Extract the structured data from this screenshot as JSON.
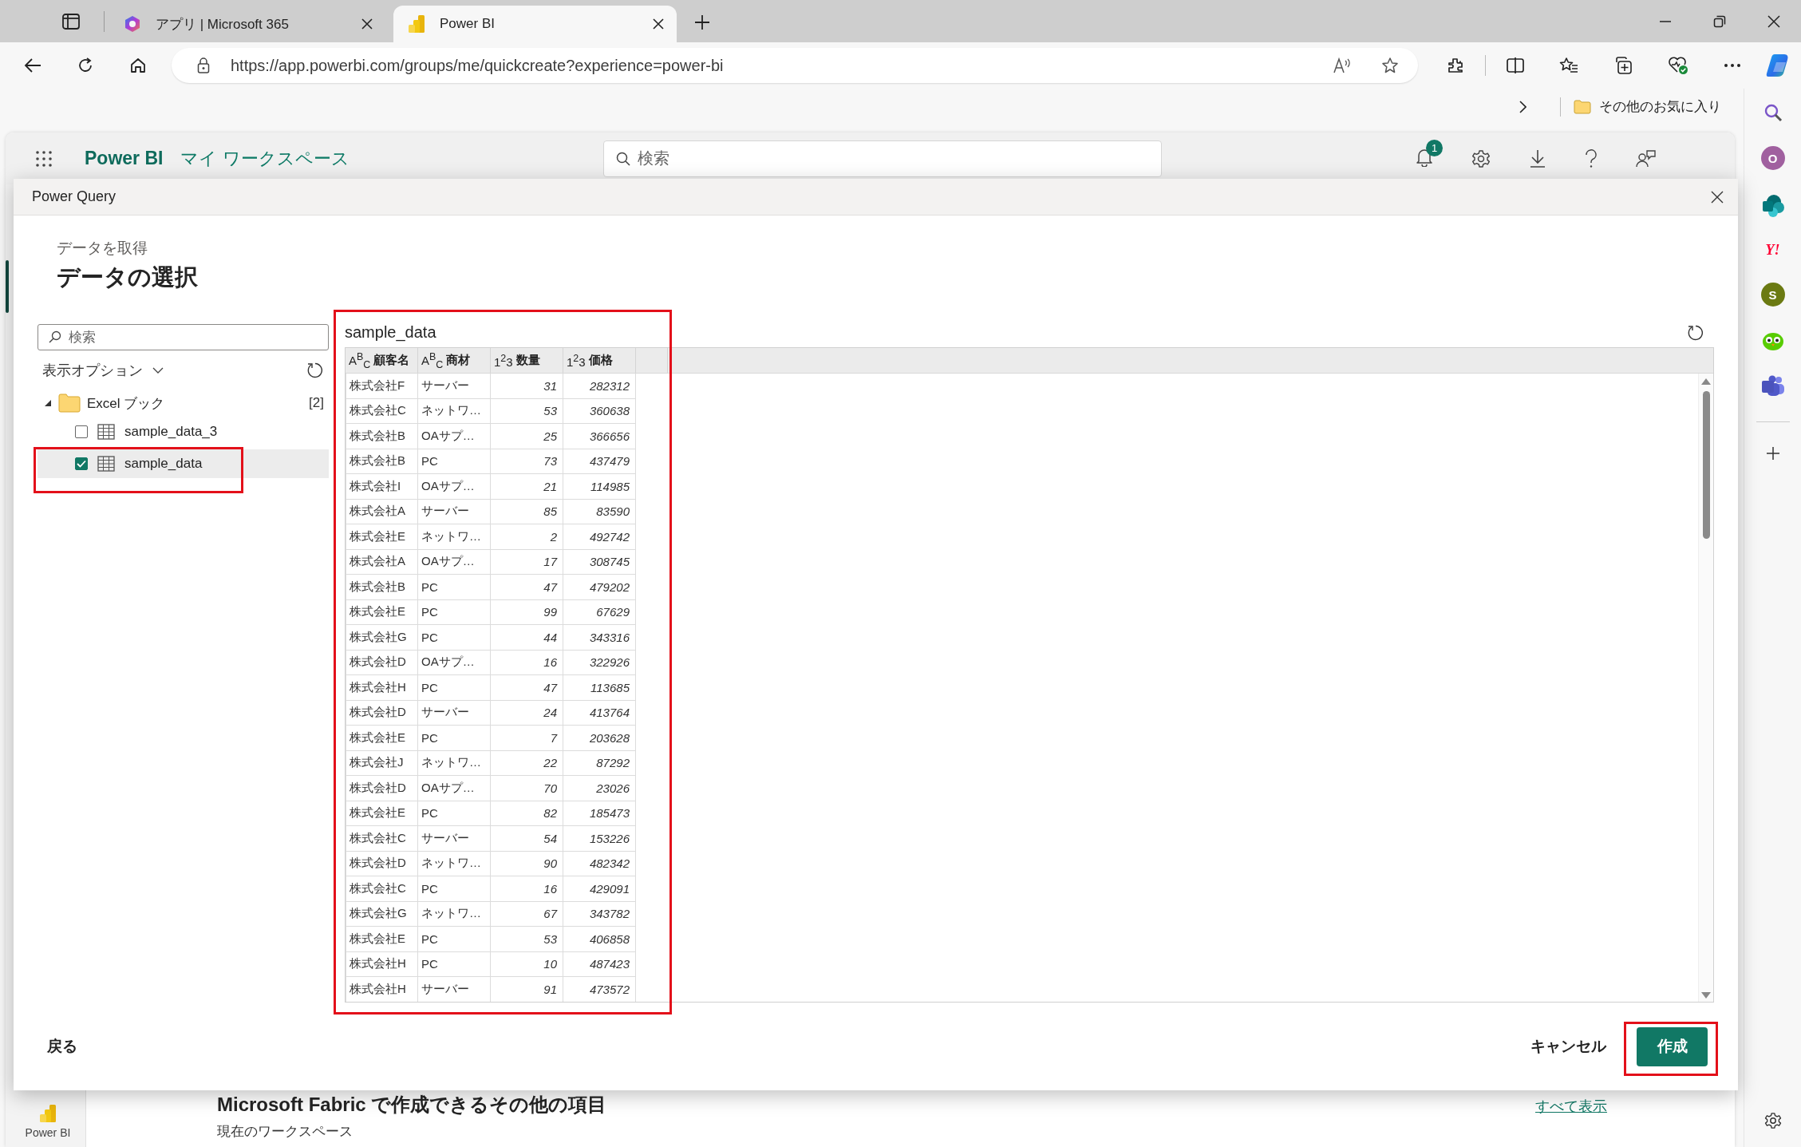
{
  "browser": {
    "tabs": [
      {
        "title": "アプリ | Microsoft 365",
        "kind": "suite",
        "selected": false
      },
      {
        "title": "Power BI",
        "kind": "report",
        "selected": true
      }
    ],
    "address": "https://app.powerbi.com/groups/me/quickcreate?experience=power-bi",
    "favorites_folder": "その他のお気に入り"
  },
  "app_header": {
    "product": "Power BI",
    "workspace": "マイ ワークスペース",
    "search_placeholder": "検索",
    "notification_count": "1"
  },
  "dialog": {
    "title": "Power Query",
    "breadcrumb": "データを取得",
    "heading": "データの選択",
    "navigator": {
      "search_placeholder": "検索",
      "display_options": "表示オプション",
      "folder": {
        "label": "Excel ブック",
        "count": "[2]",
        "expanded": true,
        "children": [
          {
            "label": "sample_data_3",
            "checked": false,
            "selected": false
          },
          {
            "label": "sample_data",
            "checked": true,
            "selected": true
          }
        ]
      }
    },
    "preview": {
      "title": "sample_data",
      "columns": [
        {
          "type_mark": "A$^{B}$$_{C}$",
          "name": "顧客名",
          "kind": "text"
        },
        {
          "type_mark": "A$^{B}$$_{C}$",
          "name": "商材",
          "kind": "text"
        },
        {
          "type_mark": "1$^{2}$3",
          "name": "数量",
          "kind": "number"
        },
        {
          "type_mark": "1$^{2}$3",
          "name": "価格",
          "kind": "number"
        }
      ],
      "rows": [
        [
          "株式会社F",
          "サーバー",
          "31",
          "282312"
        ],
        [
          "株式会社C",
          "ネットワ…",
          "53",
          "360638"
        ],
        [
          "株式会社B",
          "OAサプ…",
          "25",
          "366656"
        ],
        [
          "株式会社B",
          "PC",
          "73",
          "437479"
        ],
        [
          "株式会社I",
          "OAサプ…",
          "21",
          "114985"
        ],
        [
          "株式会社A",
          "サーバー",
          "85",
          "83590"
        ],
        [
          "株式会社E",
          "ネットワ…",
          "2",
          "492742"
        ],
        [
          "株式会社A",
          "OAサプ…",
          "17",
          "308745"
        ],
        [
          "株式会社B",
          "PC",
          "47",
          "479202"
        ],
        [
          "株式会社E",
          "PC",
          "99",
          "67629"
        ],
        [
          "株式会社G",
          "PC",
          "44",
          "343316"
        ],
        [
          "株式会社D",
          "OAサプ…",
          "16",
          "322926"
        ],
        [
          "株式会社H",
          "PC",
          "47",
          "113685"
        ],
        [
          "株式会社D",
          "サーバー",
          "24",
          "413764"
        ],
        [
          "株式会社E",
          "PC",
          "7",
          "203628"
        ],
        [
          "株式会社J",
          "ネットワ…",
          "22",
          "87292"
        ],
        [
          "株式会社D",
          "OAサプ…",
          "70",
          "23026"
        ],
        [
          "株式会社E",
          "PC",
          "82",
          "185473"
        ],
        [
          "株式会社C",
          "サーバー",
          "54",
          "153226"
        ],
        [
          "株式会社D",
          "ネットワ…",
          "90",
          "482342"
        ],
        [
          "株式会社C",
          "PC",
          "16",
          "429091"
        ],
        [
          "株式会社G",
          "ネットワ…",
          "67",
          "343782"
        ],
        [
          "株式会社E",
          "PC",
          "53",
          "406858"
        ],
        [
          "株式会社H",
          "PC",
          "10",
          "487423"
        ],
        [
          "株式会社H",
          "サーバー",
          "91",
          "473572"
        ]
      ]
    },
    "footer": {
      "back": "戻る",
      "cancel": "キャンセル",
      "create": "作成"
    }
  },
  "background": {
    "section_heading": "Microsoft Fabric で作成できるその他の項目",
    "see_all": "すべて表示",
    "subheading": "現在のワークスペース",
    "rail_label": "Power BI"
  },
  "edge_sidebar": {
    "apps": [
      {
        "kind": "letter",
        "label": "O",
        "color": "#a0609f"
      },
      {
        "kind": "sharepoint"
      },
      {
        "kind": "yahoo",
        "label": "Y!"
      },
      {
        "kind": "letter",
        "label": "S",
        "color": "#6b7a12"
      },
      {
        "kind": "owl"
      },
      {
        "kind": "teams"
      }
    ]
  }
}
